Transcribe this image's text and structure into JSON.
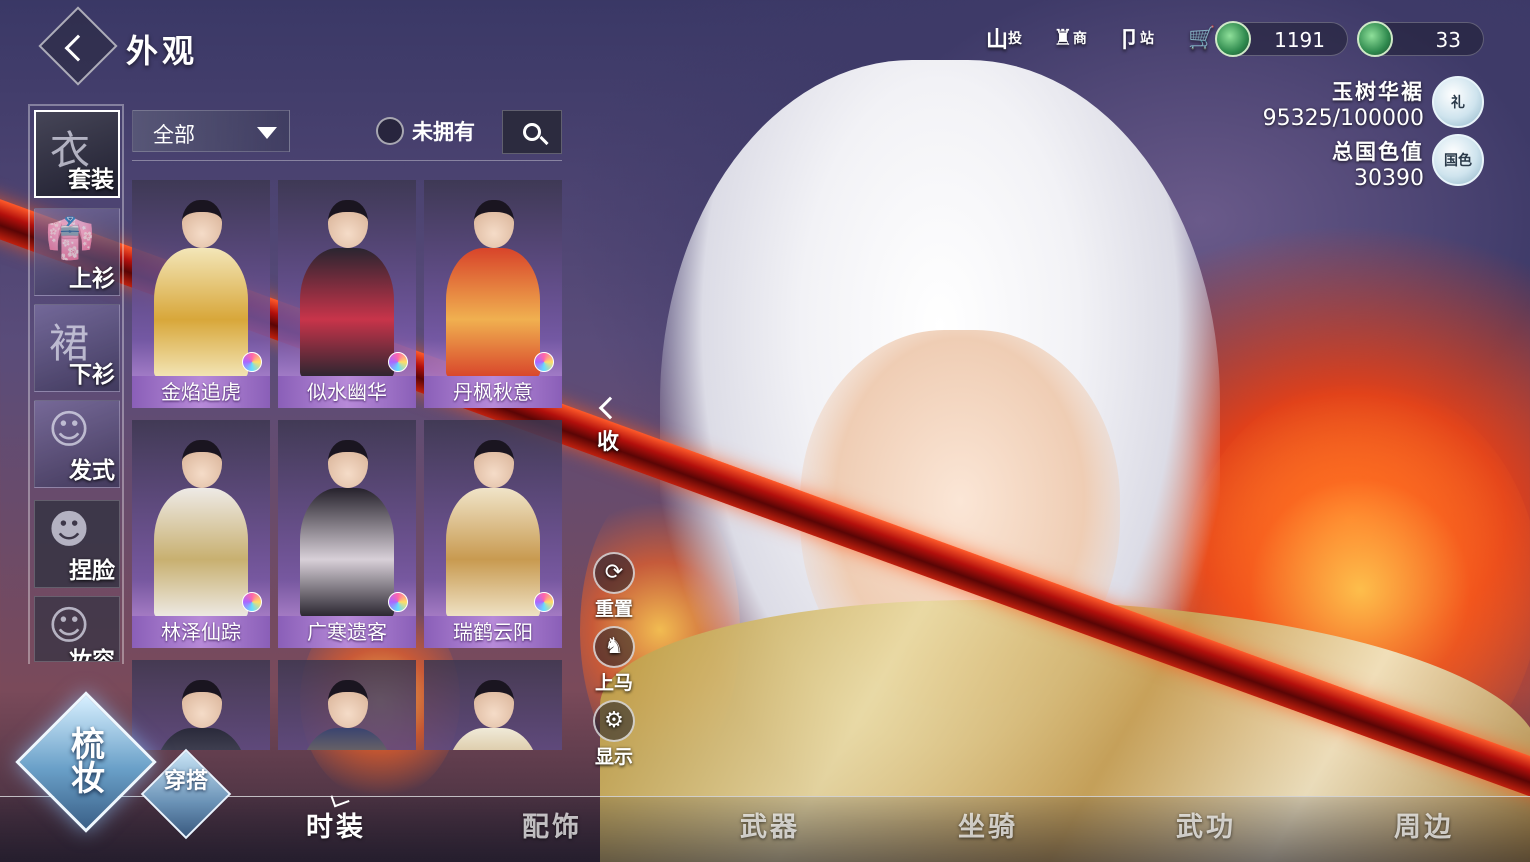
{
  "header": {
    "title": "外观",
    "shortcuts": [
      {
        "glyph": "山",
        "label": "投"
      },
      {
        "glyph": "♜",
        "label": "商"
      },
      {
        "glyph": "卩",
        "label": "站"
      },
      {
        "glyph": "🛒",
        "label": ""
      }
    ],
    "currencies": [
      {
        "amount": "1191",
        "icon": "jade-coin-icon"
      },
      {
        "amount": "33",
        "icon": "jade-coin-icon"
      }
    ]
  },
  "stats": {
    "outfit_label": "玉树华裾",
    "outfit_value": "95325/100000",
    "outfit_badge": "礼",
    "beauty_label": "总国色值",
    "beauty_value": "30390",
    "beauty_badge": "国色"
  },
  "categories": [
    {
      "label": "套装",
      "glyph": "衣",
      "active": true
    },
    {
      "label": "上衫",
      "glyph": "👘",
      "active": false
    },
    {
      "label": "下衫",
      "glyph": "裙",
      "active": false
    },
    {
      "label": "发式",
      "glyph": "☺",
      "active": false
    },
    {
      "label": "捏脸",
      "glyph": "☻",
      "active": false
    },
    {
      "label": "妆容",
      "glyph": "☺",
      "active": false
    }
  ],
  "filter": {
    "dropdown_value": "全部",
    "owned_toggle": "未拥有"
  },
  "outfits": [
    {
      "name": "金焰追虎",
      "robe": "#f3e6b8",
      "accent": "#d8a73a"
    },
    {
      "name": "似水幽华",
      "robe": "#2a2530",
      "accent": "#c8344a"
    },
    {
      "name": "丹枫秋意",
      "robe": "#d8442a",
      "accent": "#f0b050"
    },
    {
      "name": "林泽仙踪",
      "robe": "#eeeae6",
      "accent": "#c8b070"
    },
    {
      "name": "广寒遗客",
      "robe": "#26222c",
      "accent": "#d8d0d8"
    },
    {
      "name": "瑞鹤云阳",
      "robe": "#f0e4c8",
      "accent": "#c89a50"
    },
    {
      "name": "",
      "robe": "#2a2a3a",
      "accent": "#6a6a80"
    },
    {
      "name": "",
      "robe": "#3a4470",
      "accent": "#c8a050"
    },
    {
      "name": "",
      "robe": "#f0ead8",
      "accent": "#b89050"
    }
  ],
  "side_actions": {
    "collapse": "收",
    "reset": "重置",
    "mount": "上马",
    "display": "显示"
  },
  "mode_buttons": {
    "primary": "梳妆",
    "secondary": "穿搭"
  },
  "nav_tabs": [
    {
      "label": "时装",
      "active": true
    },
    {
      "label": "配饰",
      "active": false
    },
    {
      "label": "武器",
      "active": false
    },
    {
      "label": "坐骑",
      "active": false
    },
    {
      "label": "武功",
      "active": false
    },
    {
      "label": "周边",
      "active": false
    }
  ]
}
